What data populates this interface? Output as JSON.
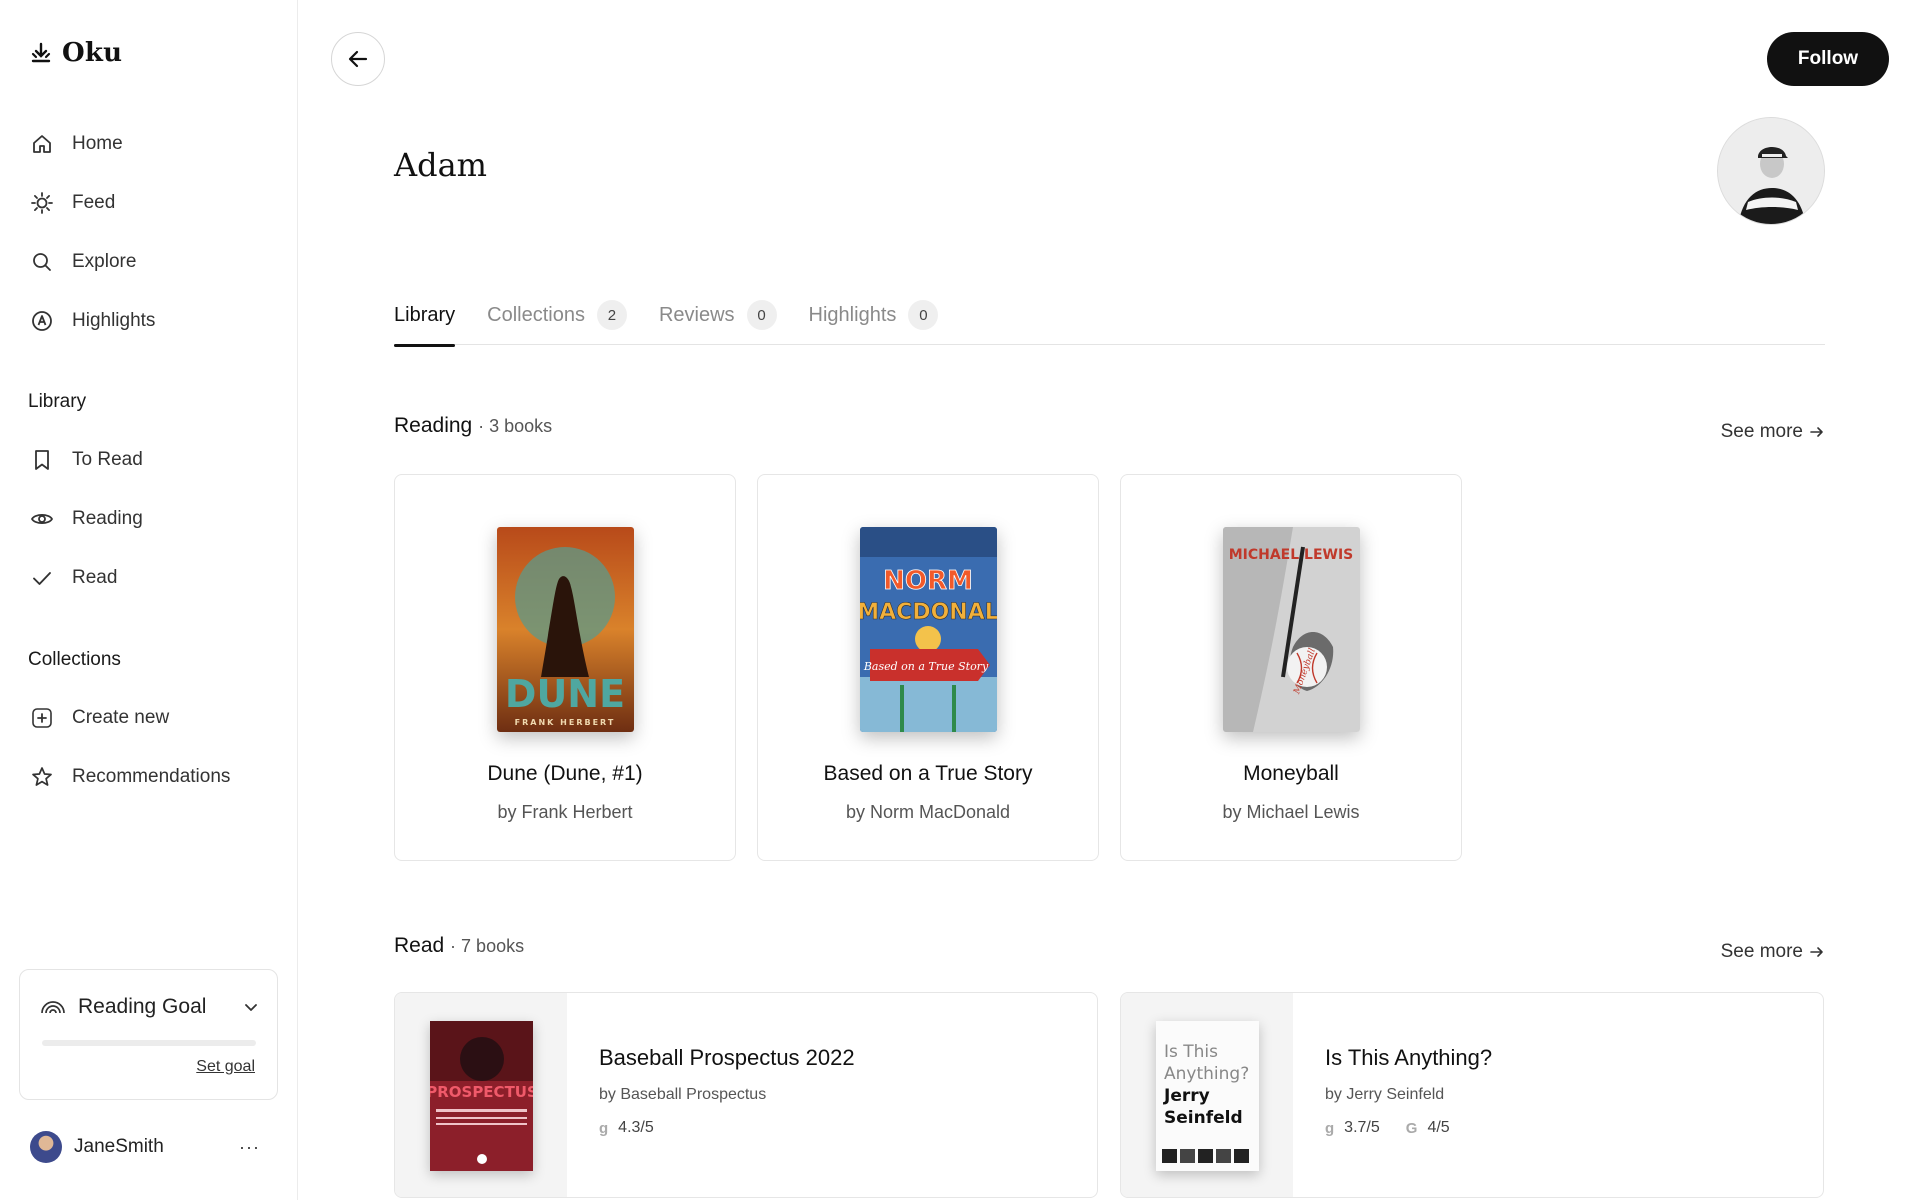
{
  "app": {
    "name": "Oku"
  },
  "sidebar": {
    "nav": [
      {
        "label": "Home",
        "icon": "home-icon"
      },
      {
        "label": "Feed",
        "icon": "sun-icon"
      },
      {
        "label": "Explore",
        "icon": "search-icon"
      },
      {
        "label": "Highlights",
        "icon": "highlight-icon"
      }
    ],
    "library_heading": "Library",
    "library": [
      {
        "label": "To Read",
        "icon": "bookmark-icon"
      },
      {
        "label": "Reading",
        "icon": "eye-icon"
      },
      {
        "label": "Read",
        "icon": "check-icon"
      }
    ],
    "collections_heading": "Collections",
    "collections": [
      {
        "label": "Create new",
        "icon": "plus-square-icon"
      },
      {
        "label": "Recommendations",
        "icon": "star-icon"
      }
    ],
    "goal": {
      "label": "Reading Goal",
      "link": "Set goal",
      "progress": 0
    },
    "user": {
      "name": "JaneSmith",
      "more": "···"
    }
  },
  "header": {
    "follow_label": "Follow"
  },
  "profile": {
    "name": "Adam"
  },
  "tabs": [
    {
      "label": "Library",
      "count": null,
      "active": true
    },
    {
      "label": "Collections",
      "count": "2",
      "active": false
    },
    {
      "label": "Reviews",
      "count": "0",
      "active": false
    },
    {
      "label": "Highlights",
      "count": "0",
      "active": false
    }
  ],
  "reading": {
    "title": "Reading",
    "count": "· 3 books",
    "see_more": "See more",
    "books": [
      {
        "title": "Dune (Dune, #1)",
        "author": "by Frank Herbert",
        "cover_top": "DUNE",
        "cover_bottom": "FRANK HERBERT"
      },
      {
        "title": "Based on a True Story",
        "author": "by Norm MacDonald",
        "cover_top": "NORM",
        "cover_mid": "MACDONAL",
        "cover_bottom": "Based on a True Story"
      },
      {
        "title": "Moneyball",
        "author": "by Michael Lewis",
        "cover_top": "MICHAEL LEWIS",
        "cover_bottom": "Moneyball"
      }
    ]
  },
  "read": {
    "title": "Read",
    "count": "· 7 books",
    "see_more": "See more",
    "books": [
      {
        "title": "Baseball Prospectus 2022",
        "author": "by Baseball Prospectus",
        "cover_text": "PROSPECTUS",
        "ratings": [
          {
            "source": "g",
            "value": "4.3/5"
          }
        ]
      },
      {
        "title": "Is This Anything?",
        "author": "by Jerry Seinfeld",
        "cover_line1": "Is This",
        "cover_line2": "Anything?",
        "cover_line3": "Jerry",
        "cover_line4": "Seinfeld",
        "ratings": [
          {
            "source": "g",
            "value": "3.7/5"
          },
          {
            "source": "G",
            "value": "4/5"
          }
        ]
      }
    ]
  }
}
